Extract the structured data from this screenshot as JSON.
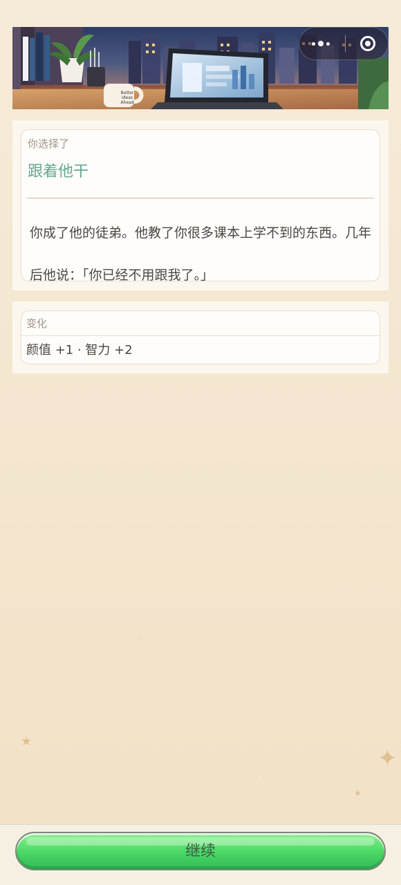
{
  "icons": {
    "more": "more-icon",
    "close": "close-icon"
  },
  "banner": {
    "mug_text": "Better Ideas Ahead"
  },
  "choice": {
    "label": "你选择了",
    "title": "跟着他干",
    "description": "你成了他的徒弟。他教了你很多课本上学不到的东西。几年后他说：「你已经不用跟我了。」"
  },
  "changes": {
    "label": "变化",
    "summary": "颜值 +1 · 智力 +2"
  },
  "footer": {
    "continue_label": "继续"
  },
  "colors": {
    "accent": "#64a894",
    "button_green": "#4fdb69",
    "text_dark": "#4b4642",
    "label_gray": "#9f948a",
    "divider_tan": "#d6b29a"
  }
}
